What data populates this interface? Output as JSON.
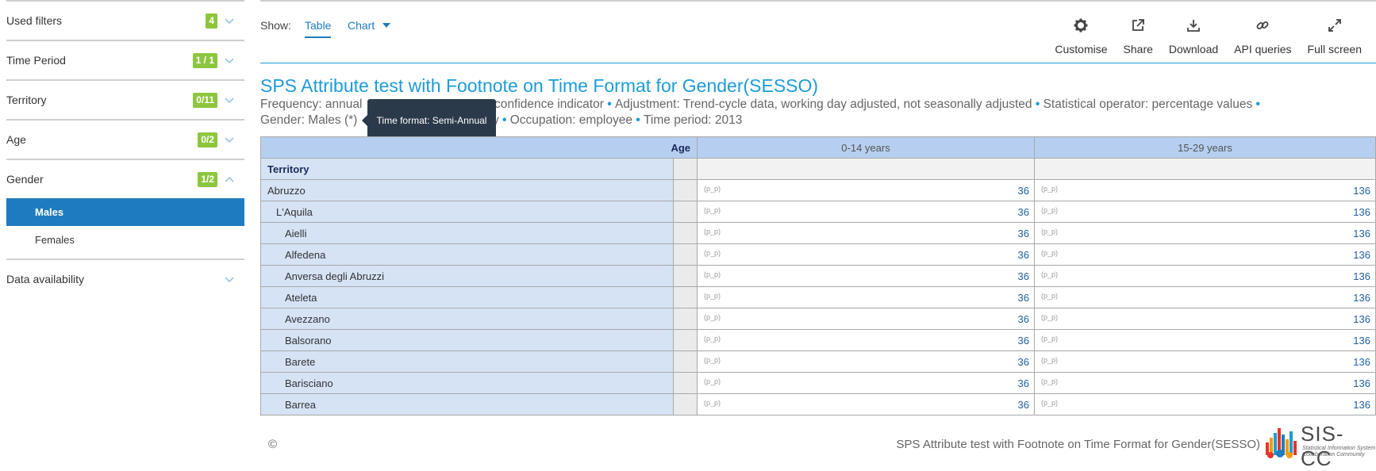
{
  "sidebar": {
    "filters": [
      {
        "label": "Used filters",
        "badge": "4"
      },
      {
        "label": "Time Period",
        "badge": "1 / 1"
      },
      {
        "label": "Territory",
        "badge": "0/11"
      },
      {
        "label": "Age",
        "badge": "0/2"
      },
      {
        "label": "Gender",
        "badge": "1/2"
      }
    ],
    "gender_options": [
      {
        "label": "Males",
        "selected": true
      },
      {
        "label": "Females",
        "selected": false
      }
    ],
    "data_availability": "Data availability"
  },
  "toolbar": {
    "show_label": "Show:",
    "tab_table": "Table",
    "tab_chart": "Chart",
    "tools": [
      {
        "label": "Customise",
        "icon": "gear-icon"
      },
      {
        "label": "Share",
        "icon": "external-link-icon"
      },
      {
        "label": "Download",
        "icon": "download-icon"
      },
      {
        "label": "API queries",
        "icon": "link-icon"
      },
      {
        "label": "Full screen",
        "icon": "expand-icon"
      }
    ]
  },
  "title": "SPS Attribute test with Footnote on Time Format for Gender(SESSO)",
  "subtitle": {
    "p1": "Frequency: annual",
    "p1_rest": "confidence indicator",
    "p2": "Adjustment: Trend-cycle data, working day adjusted, not seasonally adjusted",
    "p3": "Statistical operator: percentage values",
    "p4": "Gender: Males (*)",
    "p4_rest": "y",
    "p5": "Occupation: employee",
    "p6": "Time period: 2013"
  },
  "tooltip": "Time format: Semi-Annual",
  "table": {
    "age_header": "Age",
    "col_headers": [
      "0-14 years",
      "15-29 years"
    ],
    "row_header": "Territory",
    "rows": [
      {
        "name": "Abruzzo",
        "level": 0,
        "flag1": "(p_p)",
        "v1": "36",
        "flag2": "(p_p)",
        "v2": "136"
      },
      {
        "name": "L'Aquila",
        "level": 1,
        "flag1": "(p_p)",
        "v1": "36",
        "flag2": "(p_p)",
        "v2": "136"
      },
      {
        "name": "Aielli",
        "level": 2,
        "flag1": "(p_p)",
        "v1": "36",
        "flag2": "(p_p)",
        "v2": "136"
      },
      {
        "name": "Alfedena",
        "level": 2,
        "flag1": "(p_p)",
        "v1": "36",
        "flag2": "(p_p)",
        "v2": "136"
      },
      {
        "name": "Anversa degli Abruzzi",
        "level": 2,
        "flag1": "(p_p)",
        "v1": "36",
        "flag2": "(p_p)",
        "v2": "136"
      },
      {
        "name": "Ateleta",
        "level": 2,
        "flag1": "(p_p)",
        "v1": "36",
        "flag2": "(p_p)",
        "v2": "136"
      },
      {
        "name": "Avezzano",
        "level": 2,
        "flag1": "(p_p)",
        "v1": "36",
        "flag2": "(p_p)",
        "v2": "136"
      },
      {
        "name": "Balsorano",
        "level": 2,
        "flag1": "(p_p)",
        "v1": "36",
        "flag2": "(p_p)",
        "v2": "136"
      },
      {
        "name": "Barete",
        "level": 2,
        "flag1": "(p_p)",
        "v1": "36",
        "flag2": "(p_p)",
        "v2": "136"
      },
      {
        "name": "Barisciano",
        "level": 2,
        "flag1": "(p_p)",
        "v1": "36",
        "flag2": "(p_p)",
        "v2": "136"
      },
      {
        "name": "Barrea",
        "level": 2,
        "flag1": "(p_p)",
        "v1": "36",
        "flag2": "(p_p)",
        "v2": "136"
      }
    ]
  },
  "footer": {
    "copyright": "©",
    "title": "SPS Attribute test with Footnote on Time Format for Gender(SESSO)",
    "logo_text": "SIS-CC",
    "logo_sub1": "Statistical Information System",
    "logo_sub2": "Collaboration Community"
  },
  "colors": {
    "accent": "#1d9bd7",
    "badge": "#8cc63f",
    "selected": "#1f7bbf"
  }
}
